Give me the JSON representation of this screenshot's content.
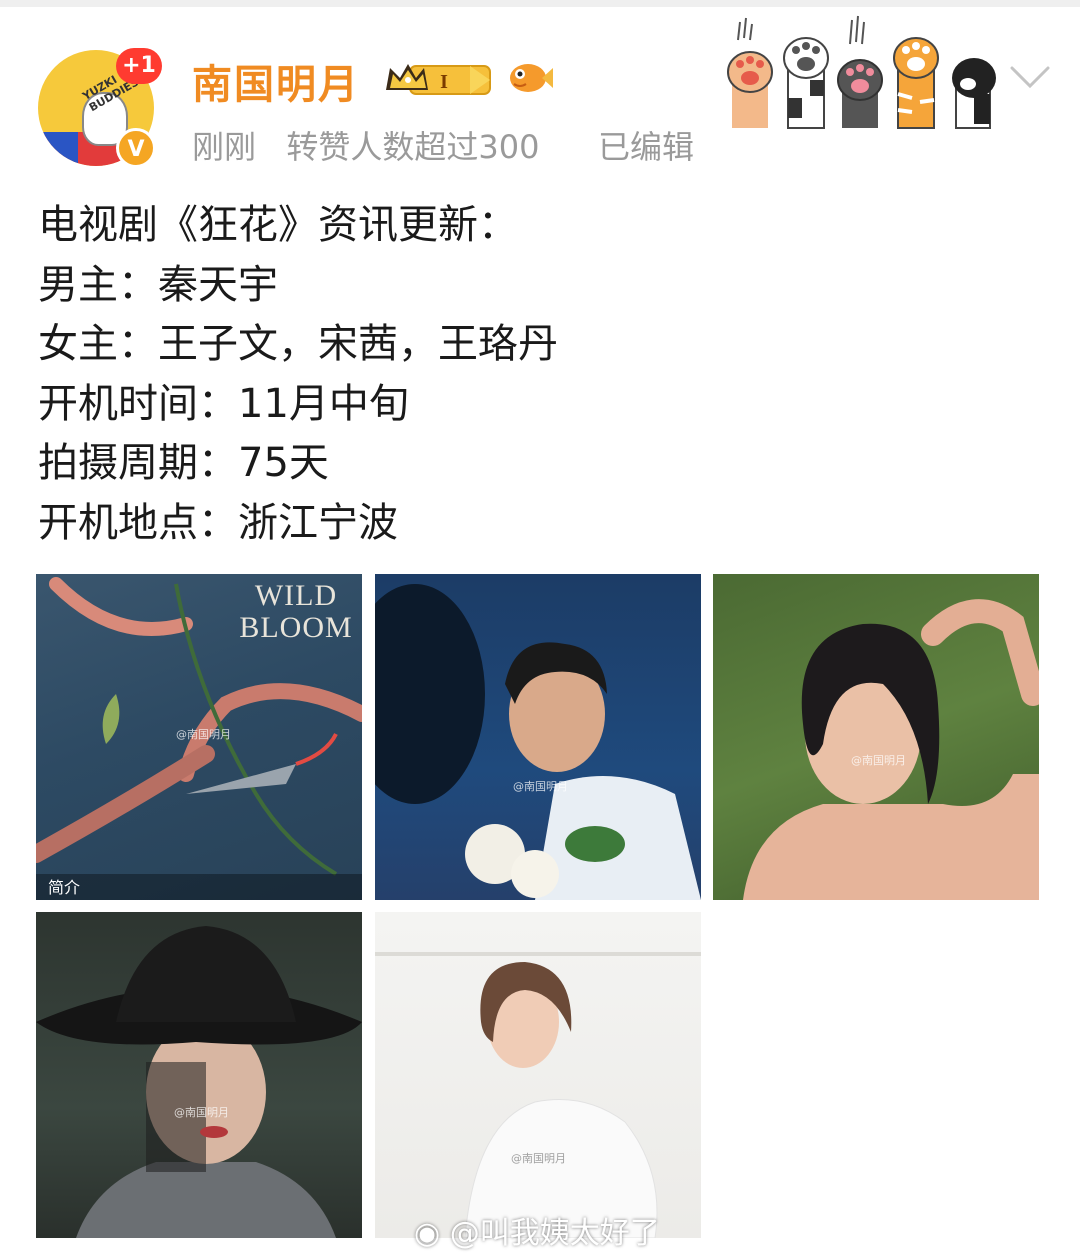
{
  "header": {
    "username": "南国明月",
    "level_badge": "I",
    "plus_badge": "+1",
    "verified_badge": "V",
    "avatar_text": "YUZKI BUDDIES",
    "time": "刚刚",
    "repost_info": "转赞人数超过300",
    "edited": "已编辑",
    "icons": [
      "crown-level-icon",
      "fish-icon",
      "cat-paws-icon",
      "chevron-down-icon"
    ]
  },
  "post": {
    "lines": [
      "电视剧《狂花》资讯更新：",
      "男主：秦天宇",
      "女主：王子文，宋茜，王珞丹",
      "开机时间：11月中旬",
      "拍摄周期：75天",
      "开机地点：浙江宁波"
    ]
  },
  "images": [
    {
      "title": "WILD BLOOM",
      "caption": "简介",
      "watermark": "@南国明月"
    },
    {
      "watermark": "@南国明月"
    },
    {
      "watermark": "@南国明月"
    },
    {
      "watermark": "@南国明月"
    },
    {
      "watermark": "@南国明月"
    }
  ],
  "footer": {
    "watermark": "@叫我姨太好了"
  },
  "colors": {
    "username": "#f08b22",
    "meta": "#9a9a9a",
    "badge_red": "#ff3b30",
    "verified": "#f5a623"
  }
}
